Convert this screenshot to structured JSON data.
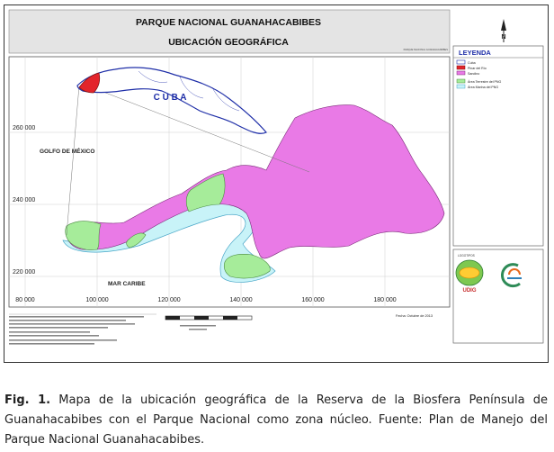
{
  "map": {
    "title": "PARQUE NACIONAL GUANAHACABIBES",
    "subtitle": "UBICACIÓN GEOGRÁFICA",
    "small_title_note": "PARQUE NACIONAL GUANAHACABIBES",
    "north_label": "N",
    "legend": {
      "title": "LEYENDA",
      "items": [
        {
          "label": "Cuba",
          "color": "#ffffff",
          "stroke": "#1f2fa8"
        },
        {
          "label": "Pinar del Río",
          "color": "#e3242b",
          "stroke": "#7a1010"
        },
        {
          "label": "Sandino",
          "color": "#e97ae6",
          "stroke": "#7a2a78"
        },
        {
          "label": "Área Terrestre del PNG",
          "color": "#a6ec9a",
          "stroke": "#4a8a40"
        },
        {
          "label": "Área Marina del PNG",
          "color": "#c8f3f8",
          "stroke": "#4aa7c8"
        }
      ]
    },
    "logos_label": "LOGOTIPOS",
    "logo_text": "UDIG",
    "inset_label": "C U B A",
    "sea_labels": {
      "gulf": "GOLFO DE MÉXICO",
      "caribbean": "MAR CARIBE"
    },
    "y_ticks": [
      "260 000",
      "240 000",
      "220 000"
    ],
    "x_ticks": [
      "80 000",
      "100 000",
      "120 000",
      "140 000",
      "160 000",
      "180 000"
    ],
    "date": "Fecha: Octubre de 2013",
    "colors": {
      "sandino": "#e97ae6",
      "terrestre": "#a6ec9a",
      "marina": "#c8f3f8",
      "pinar": "#e3242b",
      "cuba_outline": "#1f2fa8",
      "title_bar": "#e4e4e4"
    }
  },
  "caption": {
    "label": "Fig. 1.",
    "text": "Mapa de la ubicación geográfica de la Reserva de la Biosfera Península de Guanahacabibes con el Parque Nacional como zona núcleo. Fuente: Plan de Manejo del Parque Nacional Guanahacabibes."
  }
}
